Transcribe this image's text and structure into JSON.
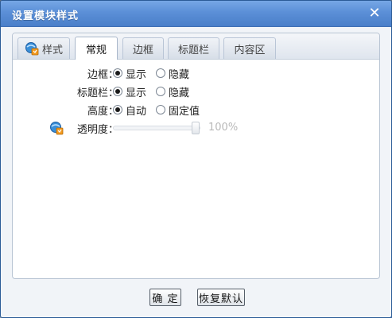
{
  "dialog": {
    "title": "设置模块样式",
    "close_label": "✕"
  },
  "tabs": [
    {
      "label": "样式",
      "icon": "style-icon"
    },
    {
      "label": "常规",
      "active": true
    },
    {
      "label": "边框"
    },
    {
      "label": "标题栏"
    },
    {
      "label": "内容区"
    }
  ],
  "rows": [
    {
      "label": "边框：",
      "options": [
        {
          "label": "显示",
          "checked": true
        },
        {
          "label": "隐藏",
          "checked": false
        }
      ]
    },
    {
      "label": "标题栏：",
      "options": [
        {
          "label": "显示",
          "checked": true
        },
        {
          "label": "隐藏",
          "checked": false
        }
      ]
    },
    {
      "label": "高度：",
      "options": [
        {
          "label": "自动",
          "checked": true
        },
        {
          "label": "固定值",
          "checked": false
        }
      ]
    }
  ],
  "opacity": {
    "label": "透明度：",
    "value_text": "100%",
    "value": 1.0,
    "icon": "opacity-icon"
  },
  "footer": {
    "ok_label": "确 定",
    "reset_label": "恢复默认"
  },
  "colors": {
    "title_bar": "#5b8fd7",
    "slider_value": "#b8b8b8"
  }
}
